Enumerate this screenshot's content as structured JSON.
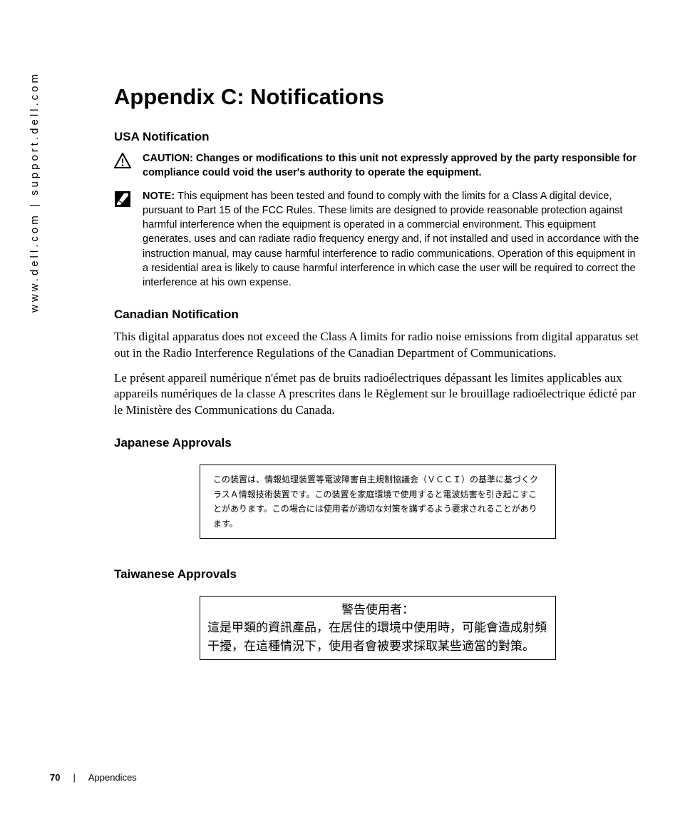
{
  "sidebar": {
    "url": "www.dell.com | support.dell.com"
  },
  "title": "Appendix C: Notifications",
  "usa": {
    "heading": "USA Notification",
    "caution_label": "CAUTION: ",
    "caution_text": "Changes or modifications to this unit not expressly approved by the party responsible for compliance could void the user's authority to operate the equipment.",
    "note_label": "NOTE: ",
    "note_text": "This equipment has been tested and found to comply with the limits for a Class A digital device, pursuant to Part 15 of the FCC Rules. These limits are designed to provide reasonable protection against harmful interference when the equipment is operated in a commercial environment. This equipment generates, uses and can radiate radio frequency energy and, if not installed and used in accordance with the instruction manual, may cause harmful interference to radio communications. Operation of this equipment in a residential area is likely to cause harmful interference in which case the user will be required to correct the interference at his own expense."
  },
  "canada": {
    "heading": "Canadian Notification",
    "para_en": "This digital apparatus does not exceed the Class A limits for radio noise emissions from digital apparatus set out in the Radio Interference Regulations of the Canadian Department of Communications.",
    "para_fr": "Le présent appareil numérique n'émet pas de bruits radioélectriques dépassant les limites applicables aux appareils numériques de la classe A prescrites dans le Règlement sur le brouillage radioélectrique édicté par le Ministère des Communications du Canada."
  },
  "japan": {
    "heading": "Japanese Approvals",
    "box_text": "この装置は、情報処理装置等電波障害自主規制協議会（ＶＣＣＩ）の基準に基づくクラスＡ情報技術装置です。この装置を家庭環境で使用すると電波妨害を引き起こすことがあります。この場合には使用者が適切な対策を講ずるよう要求されることがあります。"
  },
  "taiwan": {
    "heading": "Taiwanese Approvals",
    "line1": "警告使用者：",
    "line2": "這是甲類的資訊產品，在居住的環境中使用時，可能會造成射頻",
    "line3": "干擾，在這種情況下，使用者會被要求採取某些適當的對策。"
  },
  "footer": {
    "page_number": "70",
    "section": "Appendices"
  }
}
